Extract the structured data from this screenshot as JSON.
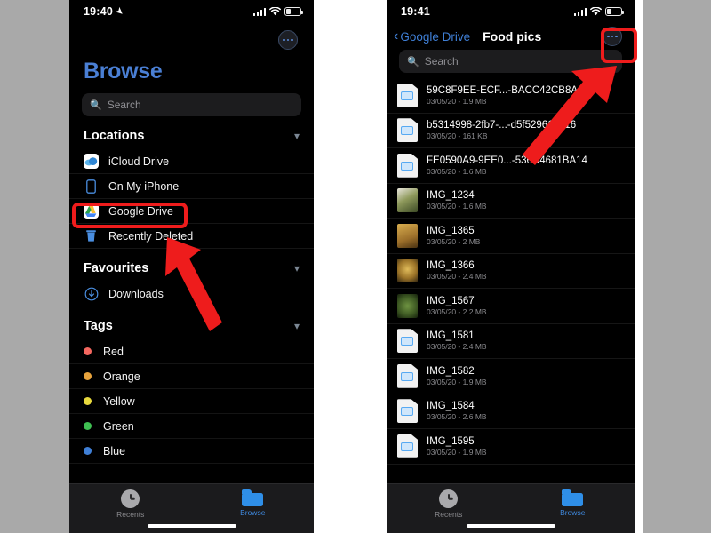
{
  "canvas": {
    "background": "#a9a9a9",
    "gap_color": "#ffffff"
  },
  "accent": {
    "blue": "#3f7fd6",
    "title_blue": "#4a7fd4",
    "highlight_red": "#ef1c1c"
  },
  "left_phone": {
    "status": {
      "time": "19:40",
      "location_icon": "location-arrow-icon",
      "signal_icon": "cellular-bars-icon",
      "wifi_icon": "wifi-icon",
      "battery_icon": "battery-icon"
    },
    "more_button": "more-options-icon",
    "title": "Browse",
    "search": {
      "placeholder": "Search",
      "icon": "search-icon"
    },
    "sections": [
      {
        "header": "Locations",
        "chevron": "chevron-down-icon",
        "rows": [
          {
            "label": "iCloud Drive",
            "icon": "icloud-drive-icon"
          },
          {
            "label": "On My iPhone",
            "icon": "iphone-icon"
          },
          {
            "label": "Google Drive",
            "icon": "google-drive-icon",
            "highlighted": true
          },
          {
            "label": "Recently Deleted",
            "icon": "trash-icon"
          }
        ]
      },
      {
        "header": "Favourites",
        "chevron": "chevron-down-icon",
        "rows": [
          {
            "label": "Downloads",
            "icon": "downloads-icon"
          }
        ]
      },
      {
        "header": "Tags",
        "chevron": "chevron-down-icon",
        "tags": [
          {
            "label": "Red",
            "color": "#f4675f"
          },
          {
            "label": "Orange",
            "color": "#e8a33d"
          },
          {
            "label": "Yellow",
            "color": "#e8d93d"
          },
          {
            "label": "Green",
            "color": "#3fbf52"
          },
          {
            "label": "Blue",
            "color": "#3f7fd6"
          }
        ]
      }
    ],
    "tabs": [
      {
        "label": "Recents",
        "icon": "clock-icon",
        "active": false
      },
      {
        "label": "Browse",
        "icon": "folder-icon",
        "active": true
      }
    ]
  },
  "right_phone": {
    "status": {
      "time": "19:41",
      "signal_icon": "cellular-bars-icon",
      "wifi_icon": "wifi-icon",
      "battery_icon": "battery-icon"
    },
    "nav": {
      "back_label": "Google Drive",
      "back_icon": "chevron-left-icon",
      "title": "Food pics",
      "more_button": "more-options-icon",
      "more_highlighted": true
    },
    "search": {
      "placeholder": "Search",
      "icon": "search-icon"
    },
    "files": [
      {
        "name": "59C8F9EE-ECF...-BACC42CB8A45",
        "sub": "03/05/20 - 1.9 MB",
        "icon": "document-image-icon"
      },
      {
        "name": "b5314998-2fb7-...-d5f52961ed16",
        "sub": "03/05/20 - 161 KB",
        "icon": "document-image-icon"
      },
      {
        "name": "FE0590A9-9EE0...-536C4681BA14",
        "sub": "03/05/20 - 1.6 MB",
        "icon": "document-image-icon"
      },
      {
        "name": "IMG_1234",
        "sub": "03/05/20 - 1.6 MB",
        "icon": "photo-thumbnail",
        "thumb": "#6d7a4a"
      },
      {
        "name": "IMG_1365",
        "sub": "03/05/20 - 2 MB",
        "icon": "photo-thumbnail",
        "thumb": "#b8913c"
      },
      {
        "name": "IMG_1366",
        "sub": "03/05/20 - 2.4 MB",
        "icon": "photo-thumbnail",
        "thumb": "#c8a040"
      },
      {
        "name": "IMG_1567",
        "sub": "03/05/20 - 2.2 MB",
        "icon": "photo-thumbnail",
        "thumb": "#4e6b33"
      },
      {
        "name": "IMG_1581",
        "sub": "03/05/20 - 2.4 MB",
        "icon": "document-image-icon"
      },
      {
        "name": "IMG_1582",
        "sub": "03/05/20 - 1.9 MB",
        "icon": "document-image-icon"
      },
      {
        "name": "IMG_1584",
        "sub": "03/05/20 - 2.6 MB",
        "icon": "document-image-icon"
      },
      {
        "name": "IMG_1595",
        "sub": "03/05/20 - 1.9 MB",
        "icon": "document-image-icon"
      }
    ],
    "tabs": [
      {
        "label": "Recents",
        "icon": "clock-icon",
        "active": false
      },
      {
        "label": "Browse",
        "icon": "folder-icon",
        "active": true
      }
    ]
  },
  "annotations": [
    {
      "name": "highlight-google-drive",
      "type": "rect"
    },
    {
      "name": "arrow-to-google-drive",
      "type": "arrow"
    },
    {
      "name": "highlight-more-button",
      "type": "rect"
    },
    {
      "name": "arrow-to-more-button",
      "type": "arrow"
    }
  ]
}
